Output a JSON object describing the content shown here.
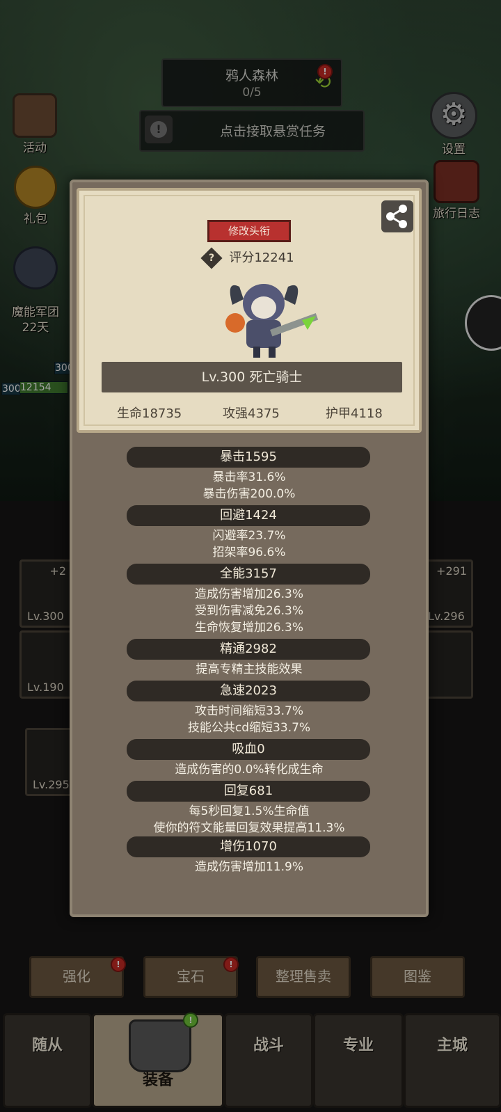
{
  "top": {
    "zone_name": "鸦人森林",
    "zone_progress": "0/5",
    "zone_alert": "!",
    "bounty_label": "点击接取悬赏任务",
    "bounty_icon": "!"
  },
  "side_left": [
    {
      "label": "活动",
      "icon": "scroll-icon"
    },
    {
      "label": "礼包",
      "icon": "coin-bag-icon"
    },
    {
      "label": "魔能军团\n22天",
      "icon": "legion-icon"
    }
  ],
  "side_right": [
    {
      "label": "设置",
      "icon": "gear-icon"
    },
    {
      "label": "旅行日志",
      "icon": "journal-icon"
    }
  ],
  "hud": {
    "level_small_1": "300",
    "level_small_2": "300",
    "hp_value": "12154"
  },
  "equipment": {
    "slots": [
      {
        "plus": "+2",
        "lv": "Lv.300"
      },
      {
        "plus": "",
        "lv": "Lv.190"
      },
      {
        "plus": "+291",
        "lv": "Lv.296"
      },
      {
        "plus": "",
        "lv": ""
      },
      {
        "plus": "",
        "lv": "Lv.295"
      }
    ]
  },
  "actions": [
    {
      "label": "强化",
      "alert": "!"
    },
    {
      "label": "宝石",
      "alert": "!"
    },
    {
      "label": "整理售卖",
      "alert": ""
    },
    {
      "label": "图鉴",
      "alert": ""
    }
  ],
  "tabs": [
    {
      "label": "随从"
    },
    {
      "label": "装备",
      "alert": "!"
    },
    {
      "label": "战斗"
    },
    {
      "label": "专业"
    },
    {
      "label": "主城"
    }
  ],
  "modal": {
    "rename_label": "修改头衔",
    "score_label": "评分12241",
    "score_help": "?",
    "title_label": "Lv.300 死亡骑士",
    "hp": "生命18735",
    "attack": "攻强4375",
    "armor": "护甲4118",
    "sections": [
      {
        "head": "暴击1595",
        "lines": [
          "暴击率31.6%",
          "暴击伤害200.0%"
        ]
      },
      {
        "head": "回避1424",
        "lines": [
          "闪避率23.7%",
          "招架率96.6%"
        ]
      },
      {
        "head": "全能3157",
        "lines": [
          "造成伤害增加26.3%",
          "受到伤害减免26.3%",
          "生命恢复增加26.3%"
        ]
      },
      {
        "head": "精通2982",
        "lines": [
          "提高专精主技能效果"
        ]
      },
      {
        "head": "急速2023",
        "lines": [
          "攻击时间缩短33.7%",
          "技能公共cd缩短33.7%"
        ]
      },
      {
        "head": "吸血0",
        "lines": [
          "造成伤害的0.0%转化成生命"
        ]
      },
      {
        "head": "回复681",
        "lines": [
          "每5秒回复1.5%生命值",
          "使你的符文能量回复效果提高11.3%"
        ]
      },
      {
        "head": "增伤1070",
        "lines": [
          "造成伤害增加11.9%"
        ]
      }
    ]
  },
  "colors": {
    "accent_red": "#b8312f",
    "parchment": "#e6dcc2",
    "panel": "#766a5d",
    "alert_green": "#6fc33a"
  }
}
